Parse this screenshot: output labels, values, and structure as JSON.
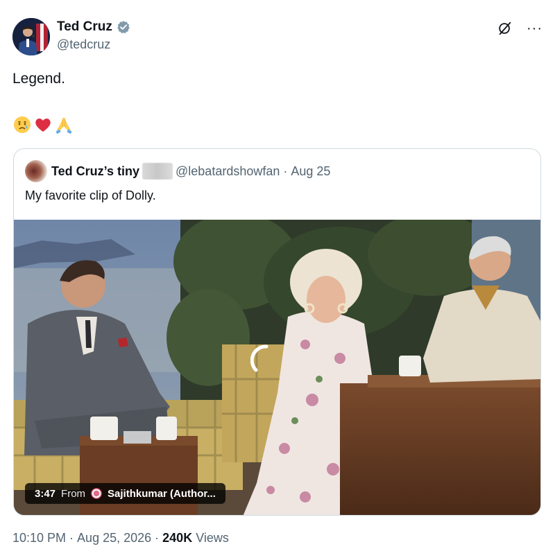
{
  "author": {
    "name": "Ted Cruz",
    "handle": "@tedcruz"
  },
  "tweet": {
    "text": "Legend.",
    "emojis": [
      "crying-face",
      "red-heart",
      "folded-hands"
    ]
  },
  "quoted": {
    "name": "Ted Cruz’s tiny",
    "handle": "@lebatardshowfan",
    "separator": "·",
    "date": "Aug 25",
    "text": "My favorite clip of Dolly.",
    "video": {
      "duration": "3:47",
      "from_label": "From",
      "source": "Sajithkumar (Author..."
    }
  },
  "footer": {
    "time": "10:10 PM",
    "separator": "·",
    "date": "Aug 25, 2026",
    "separator2": "·",
    "views_count": "240K",
    "views_label": "Views"
  },
  "colors": {
    "text_primary": "#0f1419",
    "text_secondary": "#536471",
    "verified_blue": "#829aab",
    "border": "#cfd9de"
  },
  "icons": {
    "verified": "verified-badge-icon",
    "grok": "grok-icon",
    "more": "more-options-icon"
  }
}
